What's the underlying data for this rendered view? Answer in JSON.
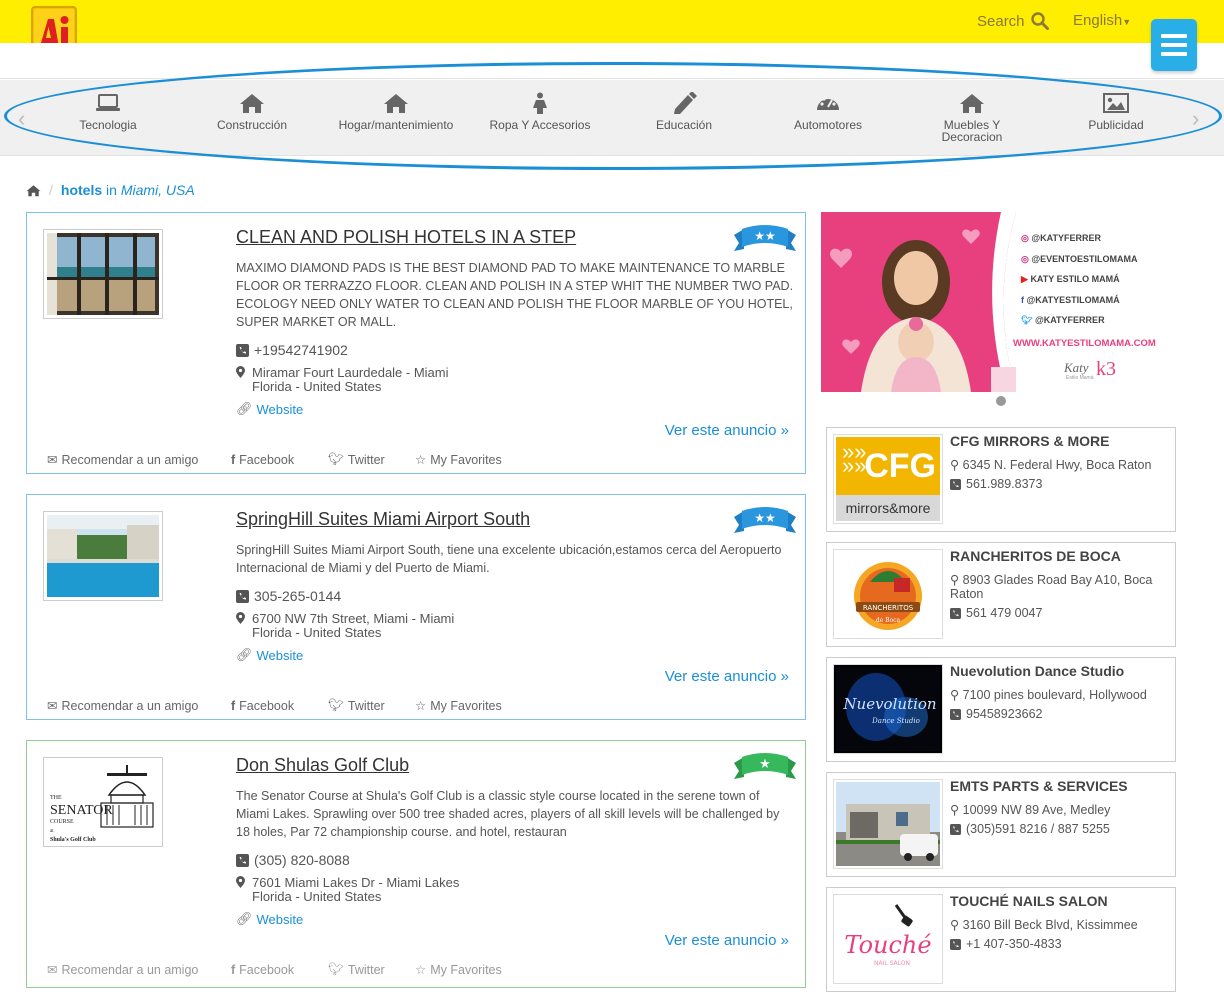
{
  "header": {
    "logo_letter": "Ai",
    "search_label": "Search",
    "language_label": "English",
    "colors": {
      "topbar": "#ffee00",
      "menu": "#29aee8",
      "link": "#1a8fd6"
    }
  },
  "categories": [
    {
      "label": "Tecnologia",
      "icon": "laptop-icon"
    },
    {
      "label": "Construcción",
      "icon": "home-icon"
    },
    {
      "label": "Hogar/mantenimiento",
      "icon": "home-icon"
    },
    {
      "label": "Ropa Y Accesorios",
      "icon": "female-icon"
    },
    {
      "label": "Educación",
      "icon": "pencil-icon"
    },
    {
      "label": "Automotores",
      "icon": "dashboard-icon"
    },
    {
      "label": "Muebles Y Decoracion",
      "icon": "home-icon"
    },
    {
      "label": "Publicidad",
      "icon": "picture-icon"
    }
  ],
  "breadcrumb": {
    "category": "hotels",
    "in": "in",
    "place": "Miami, USA"
  },
  "listings": [
    {
      "title": "CLEAN AND POLISH HOTELS IN A STEP",
      "stars": 2,
      "description": "MAXIMO DIAMOND PADS IS THE BEST DIAMOND PAD TO MAKE MAINTENANCE TO MARBLE FLOOR OR TERRAZZO FLOOR. CLEAN AND POLISH IN A STEP WHIT THE NUMBER TWO PAD. ECOLOGY NEED ONLY WATER TO CLEAN AND POLISH THE FLOOR MARBLE OF YOU HOTEL, SUPER MARKET OR MALL.",
      "phone": "+19542741902",
      "address_line1": "Miramar Fourt Laurdedale - Miami",
      "address_line2": "Florida - United States",
      "website": "Website",
      "more": "Ver este anuncio »"
    },
    {
      "title": "SpringHill Suites Miami Airport South",
      "stars": 2,
      "description": "SpringHill Suites Miami Airport South, tiene una excelente ubicación,estamos cerca del Aeropuerto Internacional de Miami y del Puerto de Miami.",
      "phone": "305-265-0144",
      "address_line1": "6700 NW 7th Street, Miami - Miami",
      "address_line2": "Florida - United States",
      "website": "Website",
      "more": "Ver este anuncio »"
    },
    {
      "title": "Don Shulas Golf Club",
      "stars": 1,
      "description": "The Senator Course at Shula's Golf Club is a classic style course located in the serene town of Miami Lakes. Sprawling over 500 tree shaded acres, players of all skill levels will be challenged by 18 holes, Par 72 championship course. and hotel, restauran",
      "phone": "(305) 820-8088",
      "address_line1": "7601 Miami Lakes Dr - Miami Lakes",
      "address_line2": "Florida - United States",
      "website": "Website",
      "more": "Ver este anuncio »",
      "logo_text_1": "THE",
      "logo_text_2": "SENATOR",
      "logo_text_3": "COURSE",
      "logo_text_4": "at",
      "logo_text_5": "Shula's Golf Club"
    }
  ],
  "listing_actions": {
    "recommend": "Recomendar a un amigo",
    "facebook": "Facebook",
    "twitter": "Twitter",
    "favorites": "My Favorites"
  },
  "banner": {
    "lines": [
      "@KATYFERRER",
      "@EVENTOESTILOMAMA",
      "KATY ESTILO MAMÁ",
      "@KATYESTILOMAMÁ",
      "@KATYFERRER"
    ],
    "url": "WWW.KATYESTILOMAMA.COM",
    "brand": "Katy",
    "brand_sub": "Estilo Mamá"
  },
  "businesses": [
    {
      "name": "CFG MIRRORS & MORE",
      "address": "6345 N. Federal Hwy, Boca Raton",
      "phone": "561.989.8373",
      "logo_text": "CFG",
      "logo_sub": "mirrors&more"
    },
    {
      "name": "RANCHERITOS DE BOCA",
      "address": "8903 Glades Road Bay A10, Boca Raton",
      "phone": "561 479 0047",
      "logo_text": "RANCHERITOS",
      "logo_sub": "de Boca"
    },
    {
      "name": "Nuevolution Dance Studio",
      "address": "7100 pines boulevard, Hollywood",
      "phone": "95458923662",
      "logo_text": "Nuevolution",
      "logo_sub": "Dance Studio"
    },
    {
      "name": "EMTS PARTS & SERVICES",
      "address": "10099 NW 89 Ave, Medley",
      "phone": "(305)591 8216 / 887 5255"
    },
    {
      "name": "TOUCHÉ NAILS SALON",
      "address": "3160 Bill Beck Blvd, Kissimmee",
      "phone": "+1 407-350-4833",
      "logo_text": "Touché",
      "logo_sub": "NAIL SALON"
    }
  ]
}
